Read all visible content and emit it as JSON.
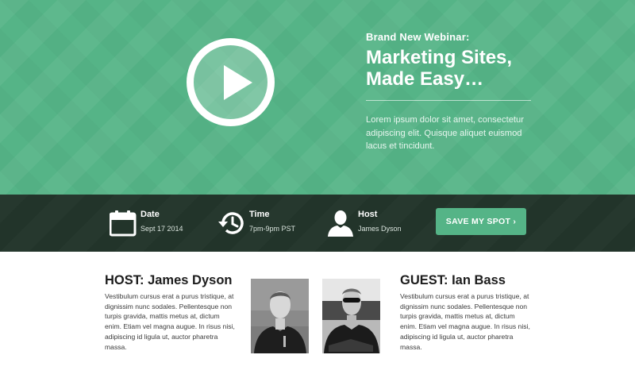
{
  "hero": {
    "eyebrow": "Brand New Webinar:",
    "headline_line1": "Marketing Sites,",
    "headline_line2": "Made Easy…",
    "lede": "Lorem ipsum dolor sit amet, consectetur adipiscing elit. Quisque aliquet euismod lacus et tincidunt.",
    "play_icon": "play-icon"
  },
  "info_bar": {
    "date": {
      "label": "Date",
      "value": "Sept 17 2014",
      "icon": "calendar-icon"
    },
    "time": {
      "label": "Time",
      "value": "7pm-9pm PST",
      "icon": "history-clock-icon"
    },
    "host": {
      "label": "Host",
      "value": "James Dyson",
      "icon": "user-silhouette-icon"
    },
    "cta_label": "SAVE MY SPOT ›"
  },
  "host": {
    "title": "HOST: James Dyson",
    "bio": "Vestibulum cursus erat a purus tristique, at dignissim nunc sodales. Pellentesque non turpis gravida, mattis metus at, dictum enim. Etiam vel magna augue. In risus nisi, adipiscing id ligula ut, auctor pharetra massa."
  },
  "guest": {
    "title": "GUEST: Ian Bass",
    "bio": "Vestibulum cursus erat a purus tristique, at dignissim nunc sodales. Pellentesque non turpis gravida, mattis metus at, dictum enim. Etiam vel magna augue. In risus nisi, adipiscing id ligula ut, auctor pharetra massa."
  },
  "colors": {
    "brand_green": "#55b487",
    "bar_dark": "#22342a",
    "text_dark": "#1c1c1c"
  }
}
